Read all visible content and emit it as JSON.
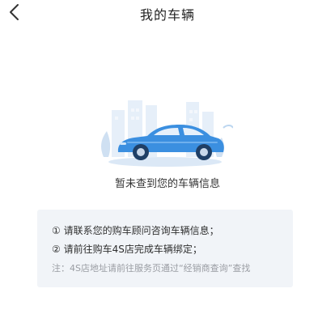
{
  "header": {
    "title": "我的车辆",
    "back_icon": "chevron-left-icon"
  },
  "empty_state": {
    "illustration": "car-city-illustration",
    "message": "暂未查到您的车辆信息"
  },
  "info_card": {
    "line1": "① 请联系您的购车顾问咨询车辆信息；",
    "line2": "② 请前往购车4S店完成车辆绑定；",
    "note": "注：4S店地址请前往服务页通过“经销商查询”查找"
  },
  "colors": {
    "car_blue": "#3b8fe0",
    "card_bg": "#f1f4f8",
    "note_gray": "#9a9da3"
  }
}
